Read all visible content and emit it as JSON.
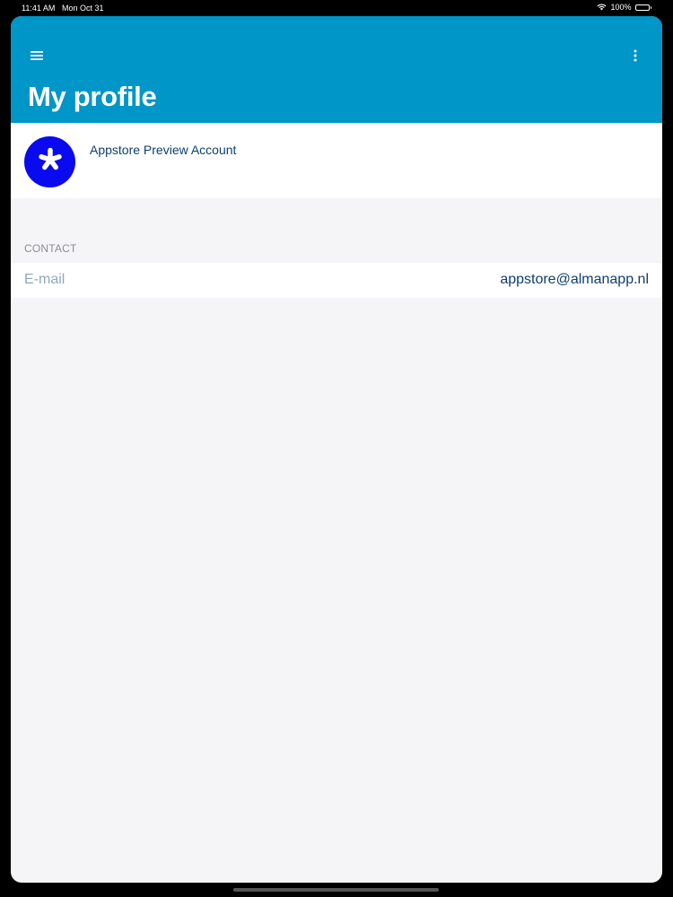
{
  "status_bar": {
    "time": "11:41 AM",
    "date": "Mon Oct 31",
    "battery": "100%",
    "wifi_icon": "wifi-icon",
    "battery_icon": "battery-icon"
  },
  "header": {
    "title": "My profile",
    "menu_icon": "hamburger-menu-icon",
    "more_icon": "more-vertical-icon",
    "background_color": "#0096c7"
  },
  "profile": {
    "name": "Appstore Preview Account",
    "avatar_icon": "asterisk-icon",
    "avatar_color": "#0a0af0"
  },
  "contact": {
    "section_label": "CONTACT",
    "rows": [
      {
        "label": "E-mail",
        "value": "appstore@almanapp.nl"
      }
    ]
  }
}
